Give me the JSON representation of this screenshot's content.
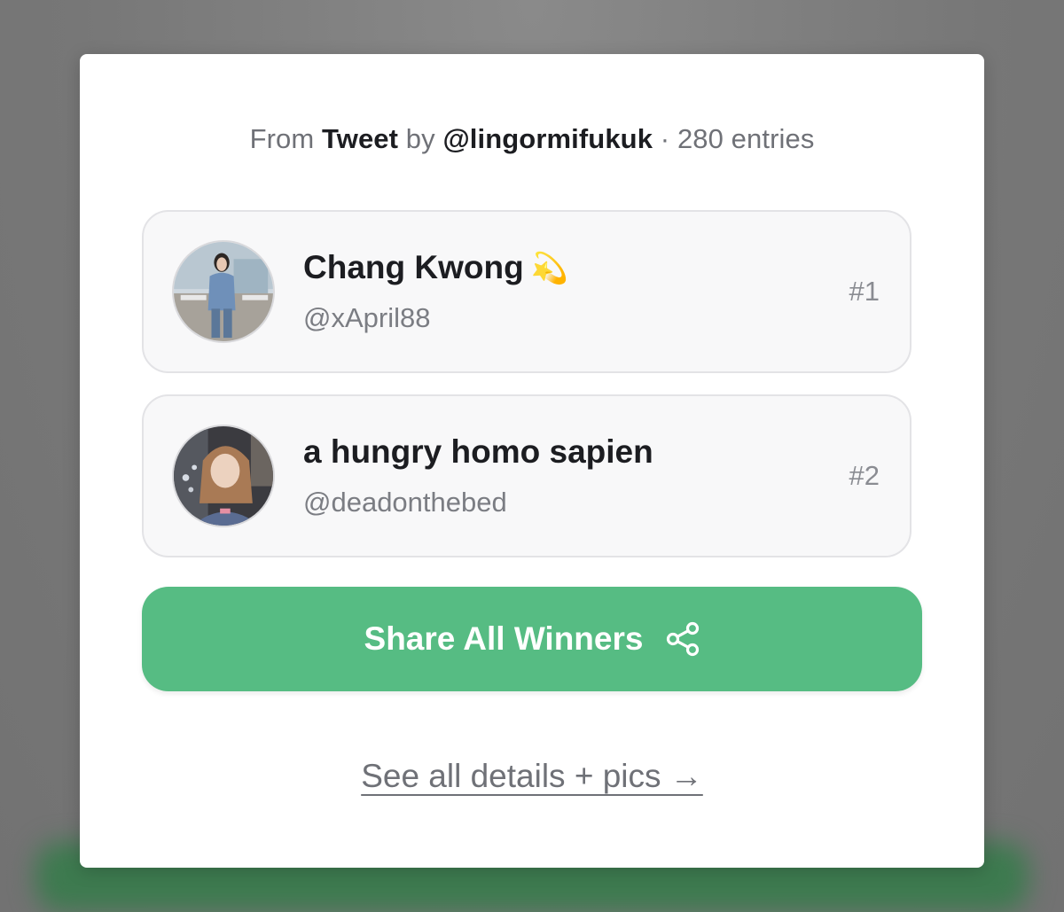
{
  "source": {
    "prefix": "From",
    "source_type": "Tweet",
    "by_text": "by",
    "author": "@lingormifukuk",
    "separator": "·",
    "entries": "280 entries"
  },
  "winners": [
    {
      "name": "Chang Kwong",
      "emoji": "💫",
      "handle": "@xApril88",
      "rank": "#1",
      "avatar_icon": "avatar-photo"
    },
    {
      "name": "a hungry homo sapien",
      "emoji": "",
      "handle": "@deadonthebed",
      "rank": "#2",
      "avatar_icon": "avatar-photo"
    }
  ],
  "share_button": {
    "label": "Share All Winners",
    "icon": "share-icon",
    "color": "#56bc83"
  },
  "details_link": {
    "label": "See all details + pics →"
  }
}
